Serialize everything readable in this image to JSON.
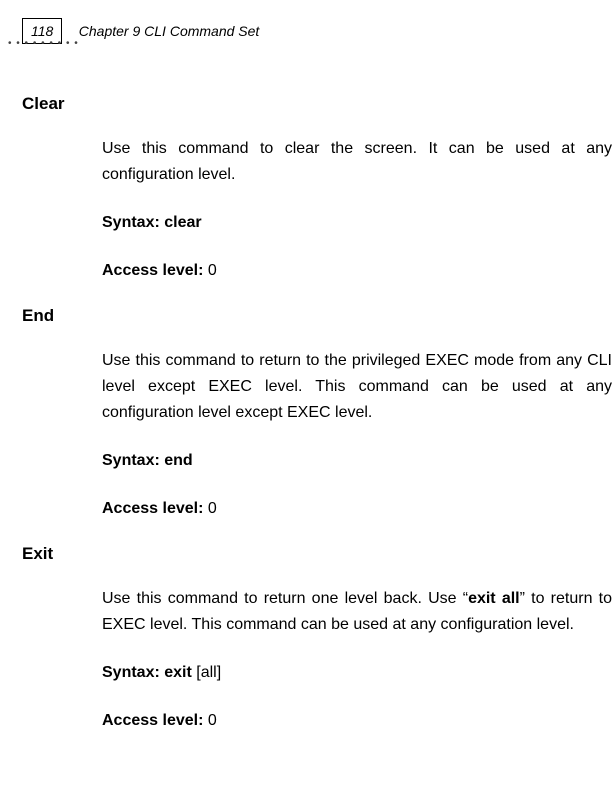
{
  "header": {
    "page_number": "118",
    "chapter_title": "Chapter 9 CLI Command Set"
  },
  "sections": {
    "clear": {
      "heading": "Clear",
      "description": "Use this command to clear the screen. It can be used at any configuration level.",
      "syntax_label": "Syntax:",
      "syntax_value": "clear",
      "access_label": "Access level:",
      "access_value": "0"
    },
    "end": {
      "heading": "End",
      "description": "Use this command to return to the privileged EXEC mode from any CLI level except EXEC level. This command can be used at any configuration level except EXEC level.",
      "syntax_label": "Syntax:",
      "syntax_value": "end",
      "access_label": "Access level:",
      "access_value": "0"
    },
    "exit": {
      "heading": "Exit",
      "desc_pre": "Use this command to return one level back. Use “",
      "desc_bold": "exit all",
      "desc_post": "” to return to EXEC level. This command can be used at any configuration level.",
      "syntax_label": "Syntax:",
      "syntax_value_bold": "exit",
      "syntax_value_param": " [all]",
      "access_label": "Access level:",
      "access_value": "0"
    }
  }
}
